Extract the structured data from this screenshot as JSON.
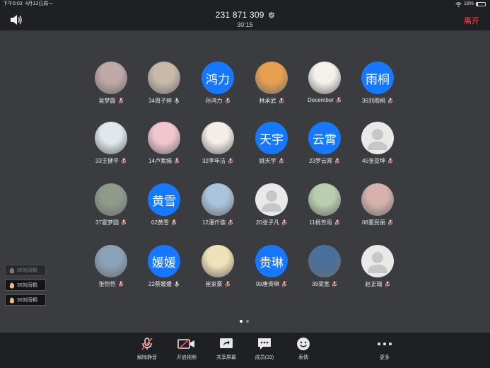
{
  "status": {
    "time": "下午5:03",
    "date": "4月13日周一",
    "battery": "18%",
    "battery_level": 0.18
  },
  "header": {
    "meeting_id": "231 871 309",
    "timer": "30:15",
    "leave_label": "离开"
  },
  "participants": [
    {
      "name": "吴梦露",
      "avatar": "photo",
      "tone": "#bfa8a8",
      "mic": "muted"
    },
    {
      "name": "34周子婷",
      "avatar": "photo",
      "tone": "#c8b9a8",
      "mic": "on"
    },
    {
      "name": "孙鸿力",
      "avatar": "text",
      "initials": "鸿力",
      "mic": "muted"
    },
    {
      "name": "林承武",
      "avatar": "photo",
      "tone": "#e8a050",
      "mic": "muted"
    },
    {
      "name": "December",
      "avatar": "photo",
      "tone": "#f4f0ec",
      "mic": "muted"
    },
    {
      "name": "36刘雨桐",
      "avatar": "text",
      "initials": "雨桐",
      "mic": "muted"
    },
    {
      "name": "33王健平",
      "avatar": "photo",
      "tone": "#dfe8ef",
      "mic": "muted"
    },
    {
      "name": "14卢紫嫣",
      "avatar": "photo",
      "tone": "#f2c6cf",
      "mic": "muted"
    },
    {
      "name": "32李年洁",
      "avatar": "photo",
      "tone": "#f4ede8",
      "mic": "muted"
    },
    {
      "name": "姚天宇",
      "avatar": "text",
      "initials": "天宇",
      "mic": "muted"
    },
    {
      "name": "23罗云霄",
      "avatar": "text",
      "initials": "云霄",
      "mic": "muted"
    },
    {
      "name": "45张亚坤",
      "avatar": "default",
      "mic": "muted"
    },
    {
      "name": "37霍梦圆",
      "avatar": "photo",
      "tone": "#8f9a8a",
      "mic": "muted"
    },
    {
      "name": "02黄雪",
      "avatar": "text",
      "initials": "黄雪",
      "mic": "muted"
    },
    {
      "name": "12潘仟璇",
      "avatar": "photo",
      "tone": "#a9c4dc",
      "mic": "muted"
    },
    {
      "name": "20张子凡",
      "avatar": "default",
      "mic": "muted"
    },
    {
      "name": "11杨芳雨",
      "avatar": "photo",
      "tone": "#b9cdb0",
      "mic": "muted"
    },
    {
      "name": "08董民丽",
      "avatar": "photo",
      "tone": "#d7b2ad",
      "mic": "muted"
    },
    {
      "name": "张恺恺",
      "avatar": "photo",
      "tone": "#8aa2b8",
      "mic": "muted"
    },
    {
      "name": "22蔡媛媛",
      "avatar": "text",
      "initials": "媛媛",
      "mic": "on"
    },
    {
      "name": "崔家豪",
      "avatar": "photo",
      "tone": "#f0e2b8",
      "mic": "muted"
    },
    {
      "name": "09唐贵琳",
      "avatar": "text",
      "initials": "贵琳",
      "mic": "muted"
    },
    {
      "name": "39梁宽",
      "avatar": "photo",
      "tone": "#4a6f9a",
      "mic": "muted"
    },
    {
      "name": "赵正瑞",
      "avatar": "default",
      "mic": "muted"
    }
  ],
  "raised_hands": [
    {
      "name": "36刘雨桐",
      "dim": true
    },
    {
      "name": "36刘雨桐",
      "dim": false
    },
    {
      "name": "36刘雨桐",
      "dim": false
    }
  ],
  "toolbar": {
    "unmute_label": "解除静音",
    "video_label": "开启视频",
    "share_label": "共享屏幕",
    "members_label": "成员(33)",
    "reactions_label": "表情",
    "more_label": "更多"
  },
  "colors": {
    "accent": "#1677ff",
    "leave": "#ff4d4f",
    "muted": "#ff4d4f"
  }
}
